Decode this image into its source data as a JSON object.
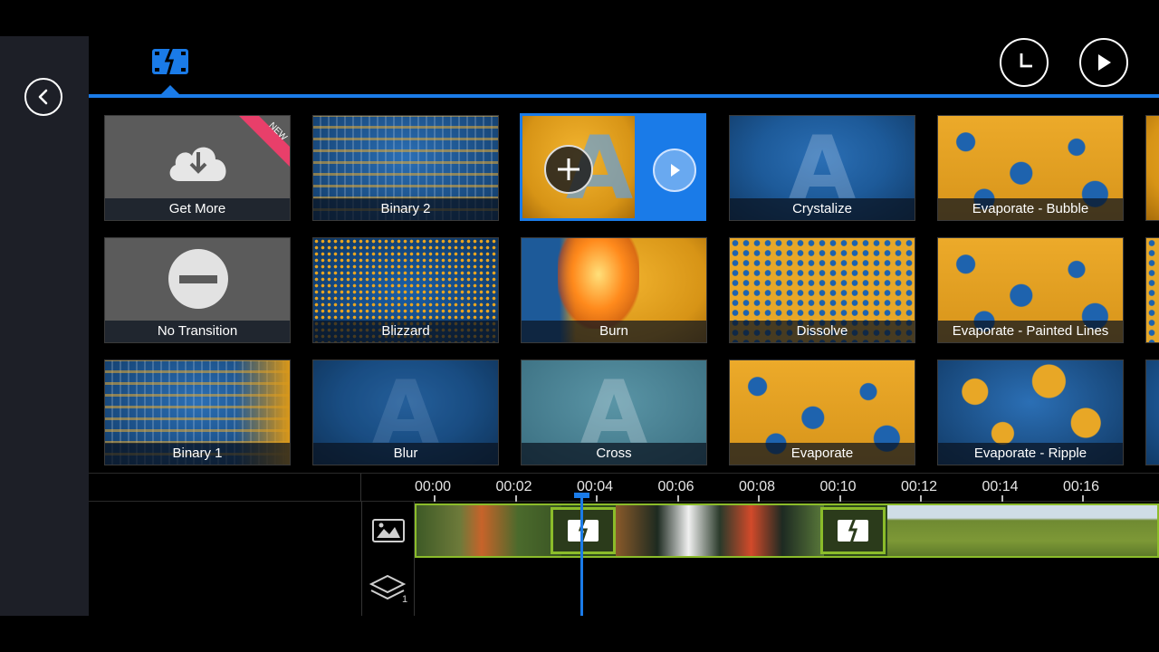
{
  "header": {
    "back": "back-icon",
    "active_tab": "transitions-icon",
    "history": "clock-icon",
    "play": "play-icon",
    "accent_color": "#1a7be8"
  },
  "tiles": [
    {
      "label": "Get More",
      "badge": "NEW"
    },
    {
      "label": "Binary 2"
    },
    {
      "label": "",
      "selected": true
    },
    {
      "label": "Crystalize"
    },
    {
      "label": "Evaporate - Bubble"
    },
    {
      "label": "No Transition"
    },
    {
      "label": "Blizzard"
    },
    {
      "label": "Burn"
    },
    {
      "label": "Dissolve"
    },
    {
      "label": "Evaporate - Painted Lines"
    },
    {
      "label": "Binary 1"
    },
    {
      "label": "Blur"
    },
    {
      "label": "Cross"
    },
    {
      "label": "Evaporate"
    },
    {
      "label": "Evaporate - Ripple"
    }
  ],
  "timeline": {
    "ticks": [
      "00:00",
      "00:02",
      "00:04",
      "00:06",
      "00:08",
      "00:10",
      "00:12",
      "00:14",
      "00:16"
    ],
    "layer_count": "1",
    "track_color": "#8bbc2a"
  }
}
